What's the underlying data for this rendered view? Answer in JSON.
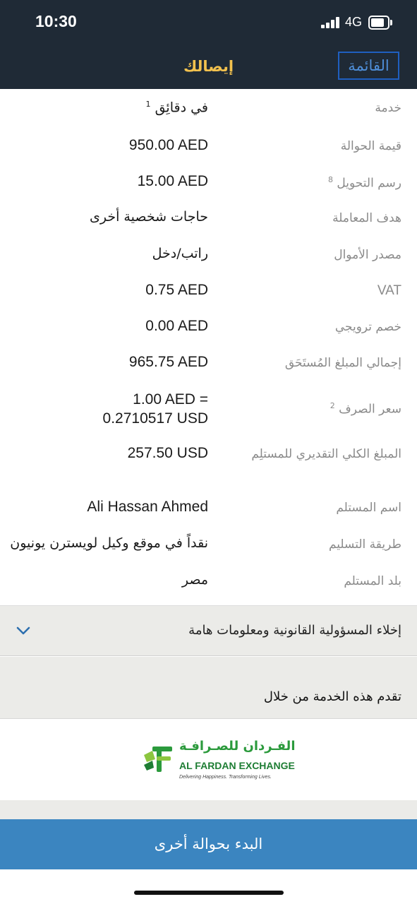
{
  "status_bar": {
    "time": "10:30",
    "network": "4G"
  },
  "nav": {
    "title": "إيصالك",
    "menu_label": "القائمة"
  },
  "rows": [
    {
      "label": "خدمة",
      "value": "في دقائِق",
      "value_sup": "1"
    },
    {
      "label": "قيمة الحوالة",
      "value": "950.00 AED"
    },
    {
      "label": "رسم التحويل",
      "label_sup": "8",
      "value": "15.00 AED"
    },
    {
      "label": "هدف المعاملة",
      "value": "حاجات شخصية أخرى"
    },
    {
      "label": "مصدر الأموال",
      "value": "راتب/دخل"
    },
    {
      "label": "VAT",
      "value": "0.75 AED"
    },
    {
      "label": "خصم ترويجي",
      "value": "0.00 AED"
    },
    {
      "label": "إجمالي المبلغ المُستَحَق",
      "value": "965.75 AED"
    },
    {
      "label": "سعر الصرف",
      "label_sup": "2",
      "value": "1.00 AED =\n0.2710517 USD"
    },
    {
      "label": "المبلغ الكلي التقديري للمستلِم",
      "value": "257.50 USD"
    },
    {
      "label": "اسم المستلم",
      "value": "Ali Hassan Ahmed"
    },
    {
      "label": "طريقة التسليم",
      "value": "نقداً في موقع وكيل لويسترن يونيون"
    },
    {
      "label": "بلد المستلم",
      "value": "مصر"
    }
  ],
  "disclaimer": {
    "label": "إخلاء المسؤولية القانونية ومعلومات هامة",
    "icon": "chevron-down-icon"
  },
  "provider": {
    "label": "تقدم هذه الخدمة من خلال",
    "logo_arabic": "الفـردان للصـرافـة",
    "logo_english": "AL FARDAN EXCHANGE",
    "logo_tagline": "Delivering Happiness. Transforming Lives."
  },
  "cta": {
    "label": "البدء بحوالة أخرى"
  },
  "colors": {
    "header_bg": "#1f2a36",
    "title": "#f2c14e",
    "menu_border": "#1f5fc0",
    "cta_bg": "#3b85c0",
    "section_bg": "#ebebe8",
    "brand_green": "#2b9a3c"
  }
}
